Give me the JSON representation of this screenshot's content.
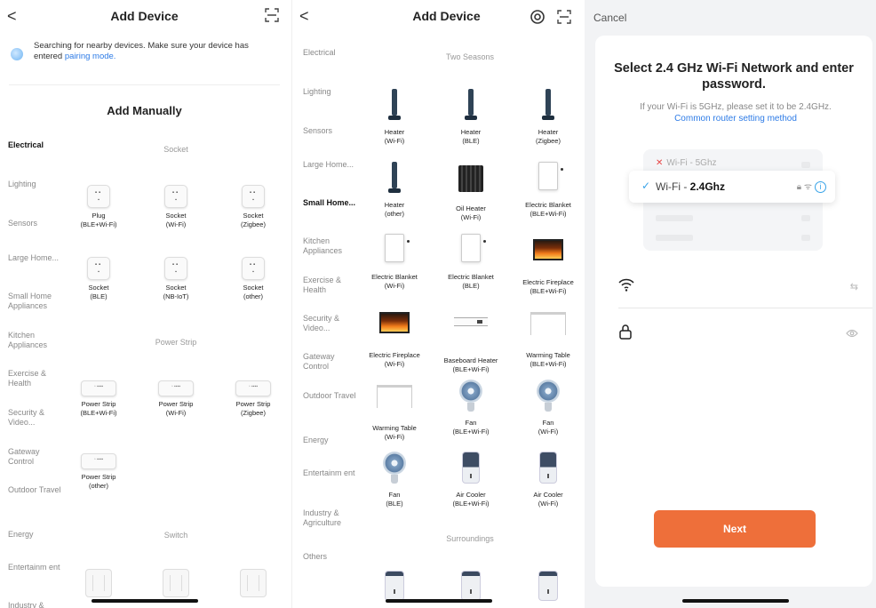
{
  "p1": {
    "title": "Add Device",
    "back": "<",
    "search_text": "Searching for nearby devices. Make sure your device has entered ",
    "search_link": "pairing mode.",
    "manual": "Add Manually",
    "categories": [
      "Electrical",
      "Lighting",
      "Sensors",
      "Large Home...",
      "Small Home Appliances",
      "Kitchen Appliances",
      "Exercise & Health",
      "Security & Video...",
      "Gateway Control",
      "Outdoor Travel",
      "Energy",
      "Entertainm ent",
      "Industry &"
    ],
    "group_socket": "Socket",
    "group_strip": "Power Strip",
    "group_switch": "Switch",
    "devices": [
      {
        "name": "Plug",
        "sub": "(BLE+Wi-Fi)"
      },
      {
        "name": "Socket",
        "sub": "(Wi-Fi)"
      },
      {
        "name": "Socket",
        "sub": "(Zigbee)"
      },
      {
        "name": "Socket",
        "sub": "(BLE)"
      },
      {
        "name": "Socket",
        "sub": "(NB-IoT)"
      },
      {
        "name": "Socket",
        "sub": "(other)"
      },
      {
        "name": "Power Strip",
        "sub": "(BLE+Wi-Fi)"
      },
      {
        "name": "Power Strip",
        "sub": "(Wi-Fi)"
      },
      {
        "name": "Power Strip",
        "sub": "(Zigbee)"
      },
      {
        "name": "Power Strip",
        "sub": "(other)"
      },
      {
        "name": "Switch",
        "sub": ""
      },
      {
        "name": "Switch",
        "sub": ""
      },
      {
        "name": "Switch",
        "sub": ""
      }
    ]
  },
  "p2": {
    "title": "Add Device",
    "back": "<",
    "categories": [
      "Electrical",
      "Lighting",
      "Sensors",
      "Large Home...",
      "Small Home...",
      "Kitchen Appliances",
      "Exercise & Health",
      "Security & Video...",
      "Gateway Control",
      "Outdoor Travel",
      "Energy",
      "Entertainm ent",
      "Industry & Agriculture",
      "Others"
    ],
    "group_two": "Two Seasons",
    "group_sur": "Surroundings",
    "devices": [
      {
        "name": "Heater",
        "sub": "(Wi-Fi)",
        "icon": "heater"
      },
      {
        "name": "Heater",
        "sub": "(BLE)",
        "icon": "heater"
      },
      {
        "name": "Heater",
        "sub": "(Zigbee)",
        "icon": "heater"
      },
      {
        "name": "Heater",
        "sub": "(other)",
        "icon": "heater"
      },
      {
        "name": "Oil Heater",
        "sub": "(Wi-Fi)",
        "icon": "oil"
      },
      {
        "name": "Electric Blanket",
        "sub": "(BLE+Wi-Fi)",
        "icon": "blanket"
      },
      {
        "name": "Electric Blanket",
        "sub": "(Wi-Fi)",
        "icon": "blanket"
      },
      {
        "name": "Electric Blanket",
        "sub": "(BLE)",
        "icon": "blanket"
      },
      {
        "name": "Electric Fireplace",
        "sub": "(BLE+Wi-Fi)",
        "icon": "fire"
      },
      {
        "name": "Electric Fireplace",
        "sub": "(Wi-Fi)",
        "icon": "fire"
      },
      {
        "name": "Baseboard Heater",
        "sub": "(BLE+Wi-Fi)",
        "icon": "base"
      },
      {
        "name": "Warming Table",
        "sub": "(BLE+Wi-Fi)",
        "icon": "table"
      },
      {
        "name": "Warming Table",
        "sub": "(Wi-Fi)",
        "icon": "table"
      },
      {
        "name": "Fan",
        "sub": "(BLE+Wi-Fi)",
        "icon": "fan"
      },
      {
        "name": "Fan",
        "sub": "(Wi-Fi)",
        "icon": "fan"
      },
      {
        "name": "Fan",
        "sub": "(BLE)",
        "icon": "fan"
      },
      {
        "name": "Air Cooler",
        "sub": "(BLE+Wi-Fi)",
        "icon": "cooler"
      },
      {
        "name": "Air Cooler",
        "sub": "(Wi-Fi)",
        "icon": "cooler"
      }
    ]
  },
  "p3": {
    "cancel": "Cancel",
    "title": "Select 2.4 GHz Wi-Fi Network and enter password.",
    "sub": "If your Wi-Fi is 5GHz, please set it to be 2.4GHz.",
    "sub_link": "Common router setting method",
    "net5": "Wi-Fi - 5Ghz",
    "net24_prefix": "Wi-Fi - ",
    "net24_bold": "2.4Ghz",
    "next": "Next",
    "accent": "#ee6f3a"
  }
}
